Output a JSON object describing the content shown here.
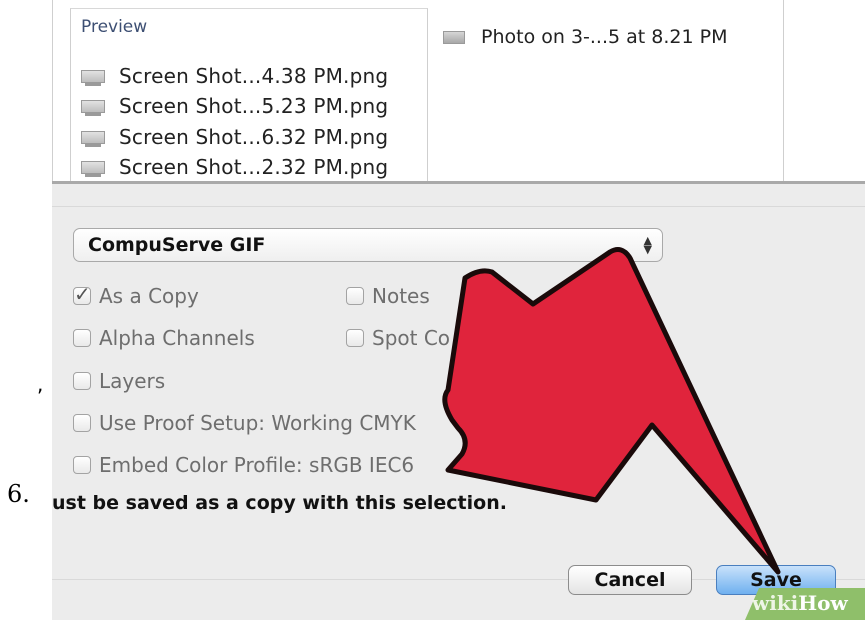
{
  "browser": {
    "preview_title": "Preview",
    "files": [
      "Screen Shot...4.38 PM.png",
      "Screen Shot...5.23 PM.png",
      "Screen Shot...6.32 PM.png",
      "Screen Shot...2.32 PM.png"
    ],
    "photo_item": "Photo on 3-...5 at 8.21 PM"
  },
  "save_options": {
    "format_selected": "CompuServe GIF",
    "checkboxes": [
      {
        "label": "As a Copy",
        "checked": true
      },
      {
        "label": "Notes",
        "checked": false
      },
      {
        "label": "Alpha Channels",
        "checked": false
      },
      {
        "label": "Spot Co",
        "checked": false
      },
      {
        "label": "Layers",
        "checked": false
      },
      {
        "label": "Use Proof Setup:  Working CMYK",
        "checked": false
      },
      {
        "label": "Embed Color Profile:  sRGB IEC6",
        "checked": false
      }
    ],
    "note": "ust be saved as a copy with this selection.",
    "cancel_label": "Cancel",
    "save_label": "Save"
  },
  "overlay": {
    "step_number": "6.",
    "stray_mark": ",",
    "arrow_color": "#e0243c",
    "watermark_wiki": "wiki",
    "watermark_how": "How",
    "watermark_color": "#8fbf6a"
  }
}
